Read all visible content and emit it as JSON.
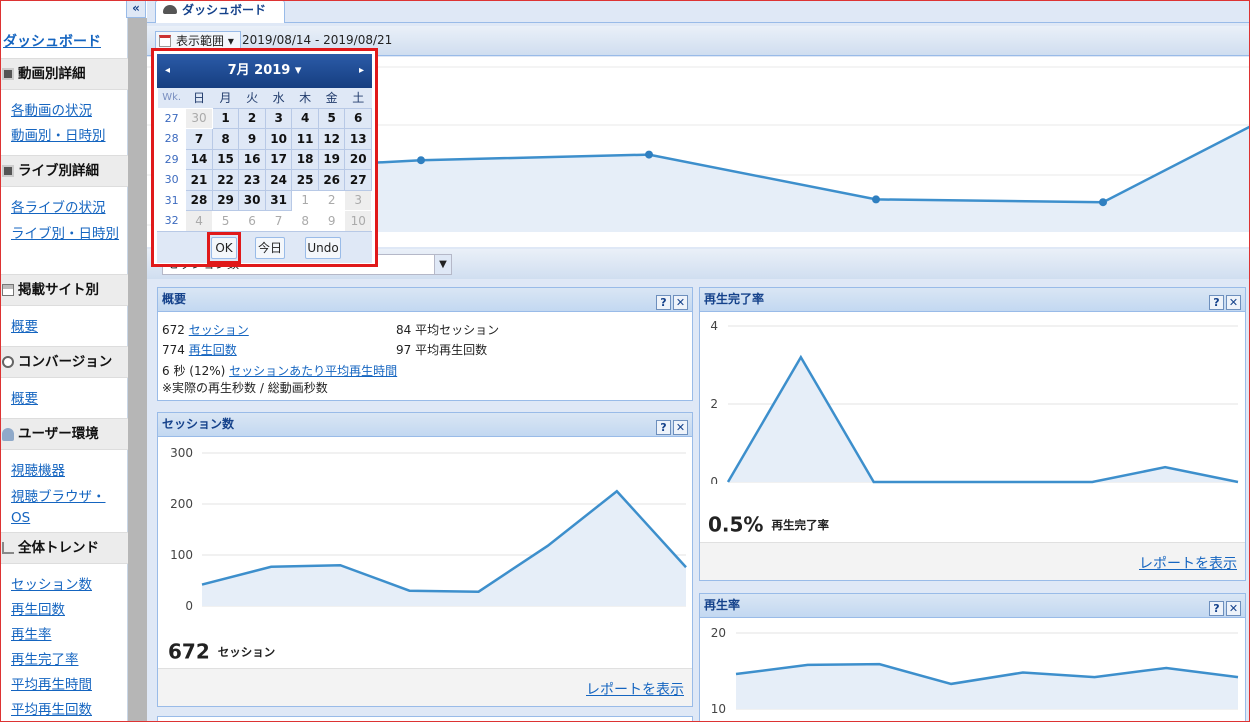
{
  "sidebar": {
    "collapse_glyph": "«",
    "title": "ダッシュボード",
    "sections": [
      {
        "label": "動画別詳細",
        "icon": "film-icon",
        "items": [
          "各動画の状況",
          "動画別・日時別"
        ]
      },
      {
        "label": "ライブ別詳細",
        "icon": "film-icon",
        "items": [
          "各ライブの状況",
          "ライブ別・日時別"
        ]
      },
      {
        "label": "掲載サイト別",
        "icon": "grid-icon",
        "items": [
          "概要"
        ]
      },
      {
        "label": "コンバージョン",
        "icon": "circle-icon",
        "items": [
          "概要"
        ]
      },
      {
        "label": "ユーザー環境",
        "icon": "user-icon",
        "items": [
          "視聴機器",
          "視聴ブラウザ・OS"
        ]
      },
      {
        "label": "全体トレンド",
        "icon": "trend-icon",
        "items": [
          "セッション数",
          "再生回数",
          "再生率",
          "再生完了率",
          "平均再生時間",
          "平均再生回数"
        ]
      }
    ]
  },
  "tab": {
    "label": "ダッシュボード"
  },
  "toolbar": {
    "range_button": "表示範囲",
    "range_value": "2019/08/14 - 2019/08/21"
  },
  "metric_combo": {
    "value": "セッション数"
  },
  "calendar": {
    "month_label": "7月 2019",
    "prev": "◂",
    "next": "▸",
    "headers": [
      "Wk.",
      "日",
      "月",
      "火",
      "水",
      "木",
      "金",
      "土"
    ],
    "weeks": [
      {
        "wk": "27",
        "days": [
          "30",
          "1",
          "2",
          "3",
          "4",
          "5",
          "6"
        ]
      },
      {
        "wk": "28",
        "days": [
          "7",
          "8",
          "9",
          "10",
          "11",
          "12",
          "13"
        ]
      },
      {
        "wk": "29",
        "days": [
          "14",
          "15",
          "16",
          "17",
          "18",
          "19",
          "20"
        ]
      },
      {
        "wk": "30",
        "days": [
          "21",
          "22",
          "23",
          "24",
          "25",
          "26",
          "27"
        ]
      },
      {
        "wk": "31",
        "days": [
          "28",
          "29",
          "30",
          "31",
          "1",
          "2",
          "3"
        ]
      },
      {
        "wk": "32",
        "days": [
          "4",
          "5",
          "6",
          "7",
          "8",
          "9",
          "10"
        ]
      }
    ],
    "ok_label": "OK",
    "today_label": "今日",
    "undo_label": "Undo"
  },
  "overview": {
    "title": "概要",
    "sessions_value": "672",
    "sessions_link": "セッション",
    "avg_sessions": "84 平均セッション",
    "plays_value": "774",
    "plays_link": "再生回数",
    "avg_plays": "97 平均再生回数",
    "avg_time_value": "6 秒 (12%)",
    "avg_time_link": "セッションあたり平均再生時間",
    "note": "※実際の再生秒数 / 総動画秒数"
  },
  "panel_tools": {
    "help": "?",
    "close": "✕"
  },
  "sessions_panel": {
    "title": "セッション数",
    "big_value": "672",
    "big_unit": "セッション",
    "report_link": "レポートを表示",
    "chart_data": {
      "type": "area",
      "ylim": [
        0,
        300
      ],
      "yticks": [
        "300",
        "200",
        "100",
        "0"
      ],
      "values": [
        42,
        77,
        80,
        30,
        28,
        118,
        225,
        76
      ]
    }
  },
  "completion_panel": {
    "title": "再生完了率",
    "big_value": "0.5%",
    "big_unit": "再生完了率",
    "report_link": "レポートを表示",
    "chart_data": {
      "type": "area",
      "ylim": [
        0,
        4
      ],
      "yticks": [
        "4",
        "2",
        "0"
      ],
      "values": [
        0,
        3.2,
        0,
        0,
        0,
        0,
        0.38,
        0
      ]
    }
  },
  "playrate_panel": {
    "title": "再生率",
    "chart_data": {
      "type": "area",
      "ylim": [
        10,
        20
      ],
      "yticks": [
        "20",
        "10"
      ],
      "values": [
        14.6,
        15.8,
        15.9,
        13.3,
        14.8,
        14.2,
        15.4,
        14.2
      ]
    }
  },
  "top_chart": {
    "chart_data": {
      "type": "line",
      "values": [
        null,
        3.1,
        3.3,
        1.7,
        1.6,
        4.3
      ],
      "points": [
        [
          0,
          3.0
        ],
        [
          1,
          3.1
        ],
        [
          2,
          3.3
        ],
        [
          3,
          1.7
        ],
        [
          4,
          1.6
        ],
        [
          5,
          4.3
        ]
      ]
    }
  }
}
